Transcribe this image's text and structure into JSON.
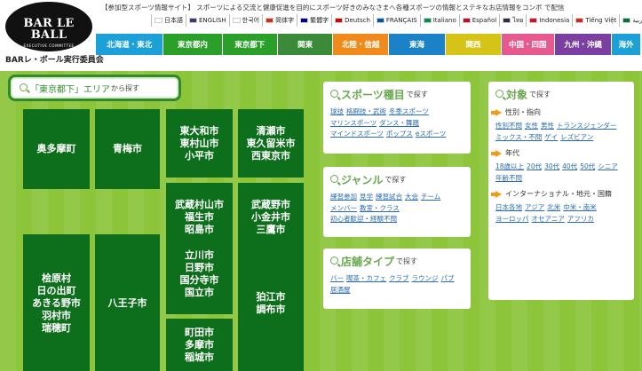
{
  "header": {
    "logo": {
      "title": "BAR LE BALL",
      "subtitle": "EXECUTIVE COMMITTEE"
    },
    "org_name": "BARレ・ボール実行委員会",
    "tagline": "【参加型スポーツ情報サイト】 スポーツによる交流と健康促進を目的にスポーツ好きのみなさまへ各種スポーツの情報とステキなお店情報をコンボ で配信",
    "languages": [
      {
        "label": "日本語",
        "flag_color": "#ffffff"
      },
      {
        "label": "ENGLISH",
        "flag_color": "#3c3b6e"
      },
      {
        "label": "한국어",
        "flag_color": "#ffffff"
      },
      {
        "label": "简体字",
        "flag_color": "#de2910"
      },
      {
        "label": "繁體字",
        "flag_color": "#000095"
      },
      {
        "label": "Deutsch",
        "flag_color": "#dd0000"
      },
      {
        "label": "FRANÇAIS",
        "flag_color": "#0055a4"
      },
      {
        "label": "Italiano",
        "flag_color": "#009246"
      },
      {
        "label": "Español",
        "flag_color": "#c60b1e"
      },
      {
        "label": "ไทย",
        "flag_color": "#2d2a4a"
      },
      {
        "label": "Indonesia",
        "flag_color": "#ce1126"
      },
      {
        "label": "Tiếng Việt",
        "flag_color": "#da251d"
      },
      {
        "label": "العربية",
        "flag_color": "#00732f"
      }
    ],
    "regions": [
      {
        "label": "北海道・東北",
        "color": "#1ba0d8"
      },
      {
        "label": "東京都内",
        "color": "#2aa02a"
      },
      {
        "label": "東京都下",
        "color": "#2aa02a"
      },
      {
        "label": "関東",
        "color": "#3a8a3a"
      },
      {
        "label": "北陸・信越",
        "color": "#f08b1b"
      },
      {
        "label": "東海",
        "color": "#1b82c8"
      },
      {
        "label": "関西",
        "color": "#d6c318"
      },
      {
        "label": "中国・四国",
        "color": "#e65a8f"
      },
      {
        "label": "九州・沖縄",
        "color": "#7a3fa0"
      },
      {
        "label": "海外",
        "color": "#1ba0d8"
      }
    ]
  },
  "area": {
    "title_open": "「",
    "title_main": "東京都下",
    "title_close": "」エリア",
    "title_suffix": "から探す",
    "cities": [
      {
        "lines": [
          "奥多摩町"
        ]
      },
      {
        "lines": [
          "青梅市"
        ]
      },
      {
        "lines": [
          "東大和市",
          "東村山市",
          "小平市"
        ]
      },
      {
        "lines": [
          "清瀬市",
          "東久留米市",
          "西東京市"
        ]
      },
      {
        "lines": [
          "武蔵村山市",
          "福生市",
          "昭島市"
        ]
      },
      {
        "lines": [
          "武蔵野市",
          "小金井市",
          "三鷹市"
        ]
      },
      {
        "lines": [
          "桧原村",
          "日の出町",
          "あきる野市",
          "羽村市",
          "瑞穂町"
        ]
      },
      {
        "lines": [
          "八王子市"
        ]
      },
      {
        "lines": [
          "立川市",
          "日野市",
          "国分寺市",
          "国立市"
        ]
      },
      {
        "lines": [
          "狛江市",
          "調布市"
        ]
      },
      {
        "lines": [
          "町田市",
          "多摩市",
          "稲城市"
        ]
      }
    ]
  },
  "sports": {
    "title": "スポーツ種目",
    "suffix": "で探す",
    "links": [
      "球技",
      "格闘技・武術",
      "冬季スポーツ",
      "マリンスポーツ",
      "ダンス・舞踏",
      "マインドスポーツ",
      "ポップス",
      "eスポーツ"
    ]
  },
  "genre": {
    "title": "ジャンル",
    "suffix": "で探す",
    "links": [
      "練習参加",
      "見学",
      "練習試合",
      "大会",
      "チーム",
      "メンバー",
      "教室・クラス",
      "初心者歓迎・経験不問"
    ]
  },
  "shop": {
    "title": "店舗タイプ",
    "suffix": "で探す",
    "links": [
      "バー",
      "喫茶・カフェ",
      "クラブ",
      "ラウンジ",
      "パブ",
      "居酒屋"
    ]
  },
  "target": {
    "title": "対象",
    "suffix": "で探す",
    "groups": [
      {
        "label": "性別・指向",
        "links": [
          "性別不問",
          "女性",
          "男性",
          "トランスジェンダー",
          "ミックス・不問",
          "ゲイ",
          "レズビアン"
        ]
      },
      {
        "label": "年代",
        "links": [
          "18歳以上",
          "20代",
          "30代",
          "40代",
          "50代",
          "シニア",
          "年齢不問"
        ]
      },
      {
        "label": "インターナショナル・地元・国籍",
        "links": [
          "日本各地",
          "アジア",
          "北米",
          "中米・南米",
          "ヨーロッパ",
          "オセアニア",
          "アフリカ"
        ]
      }
    ]
  }
}
